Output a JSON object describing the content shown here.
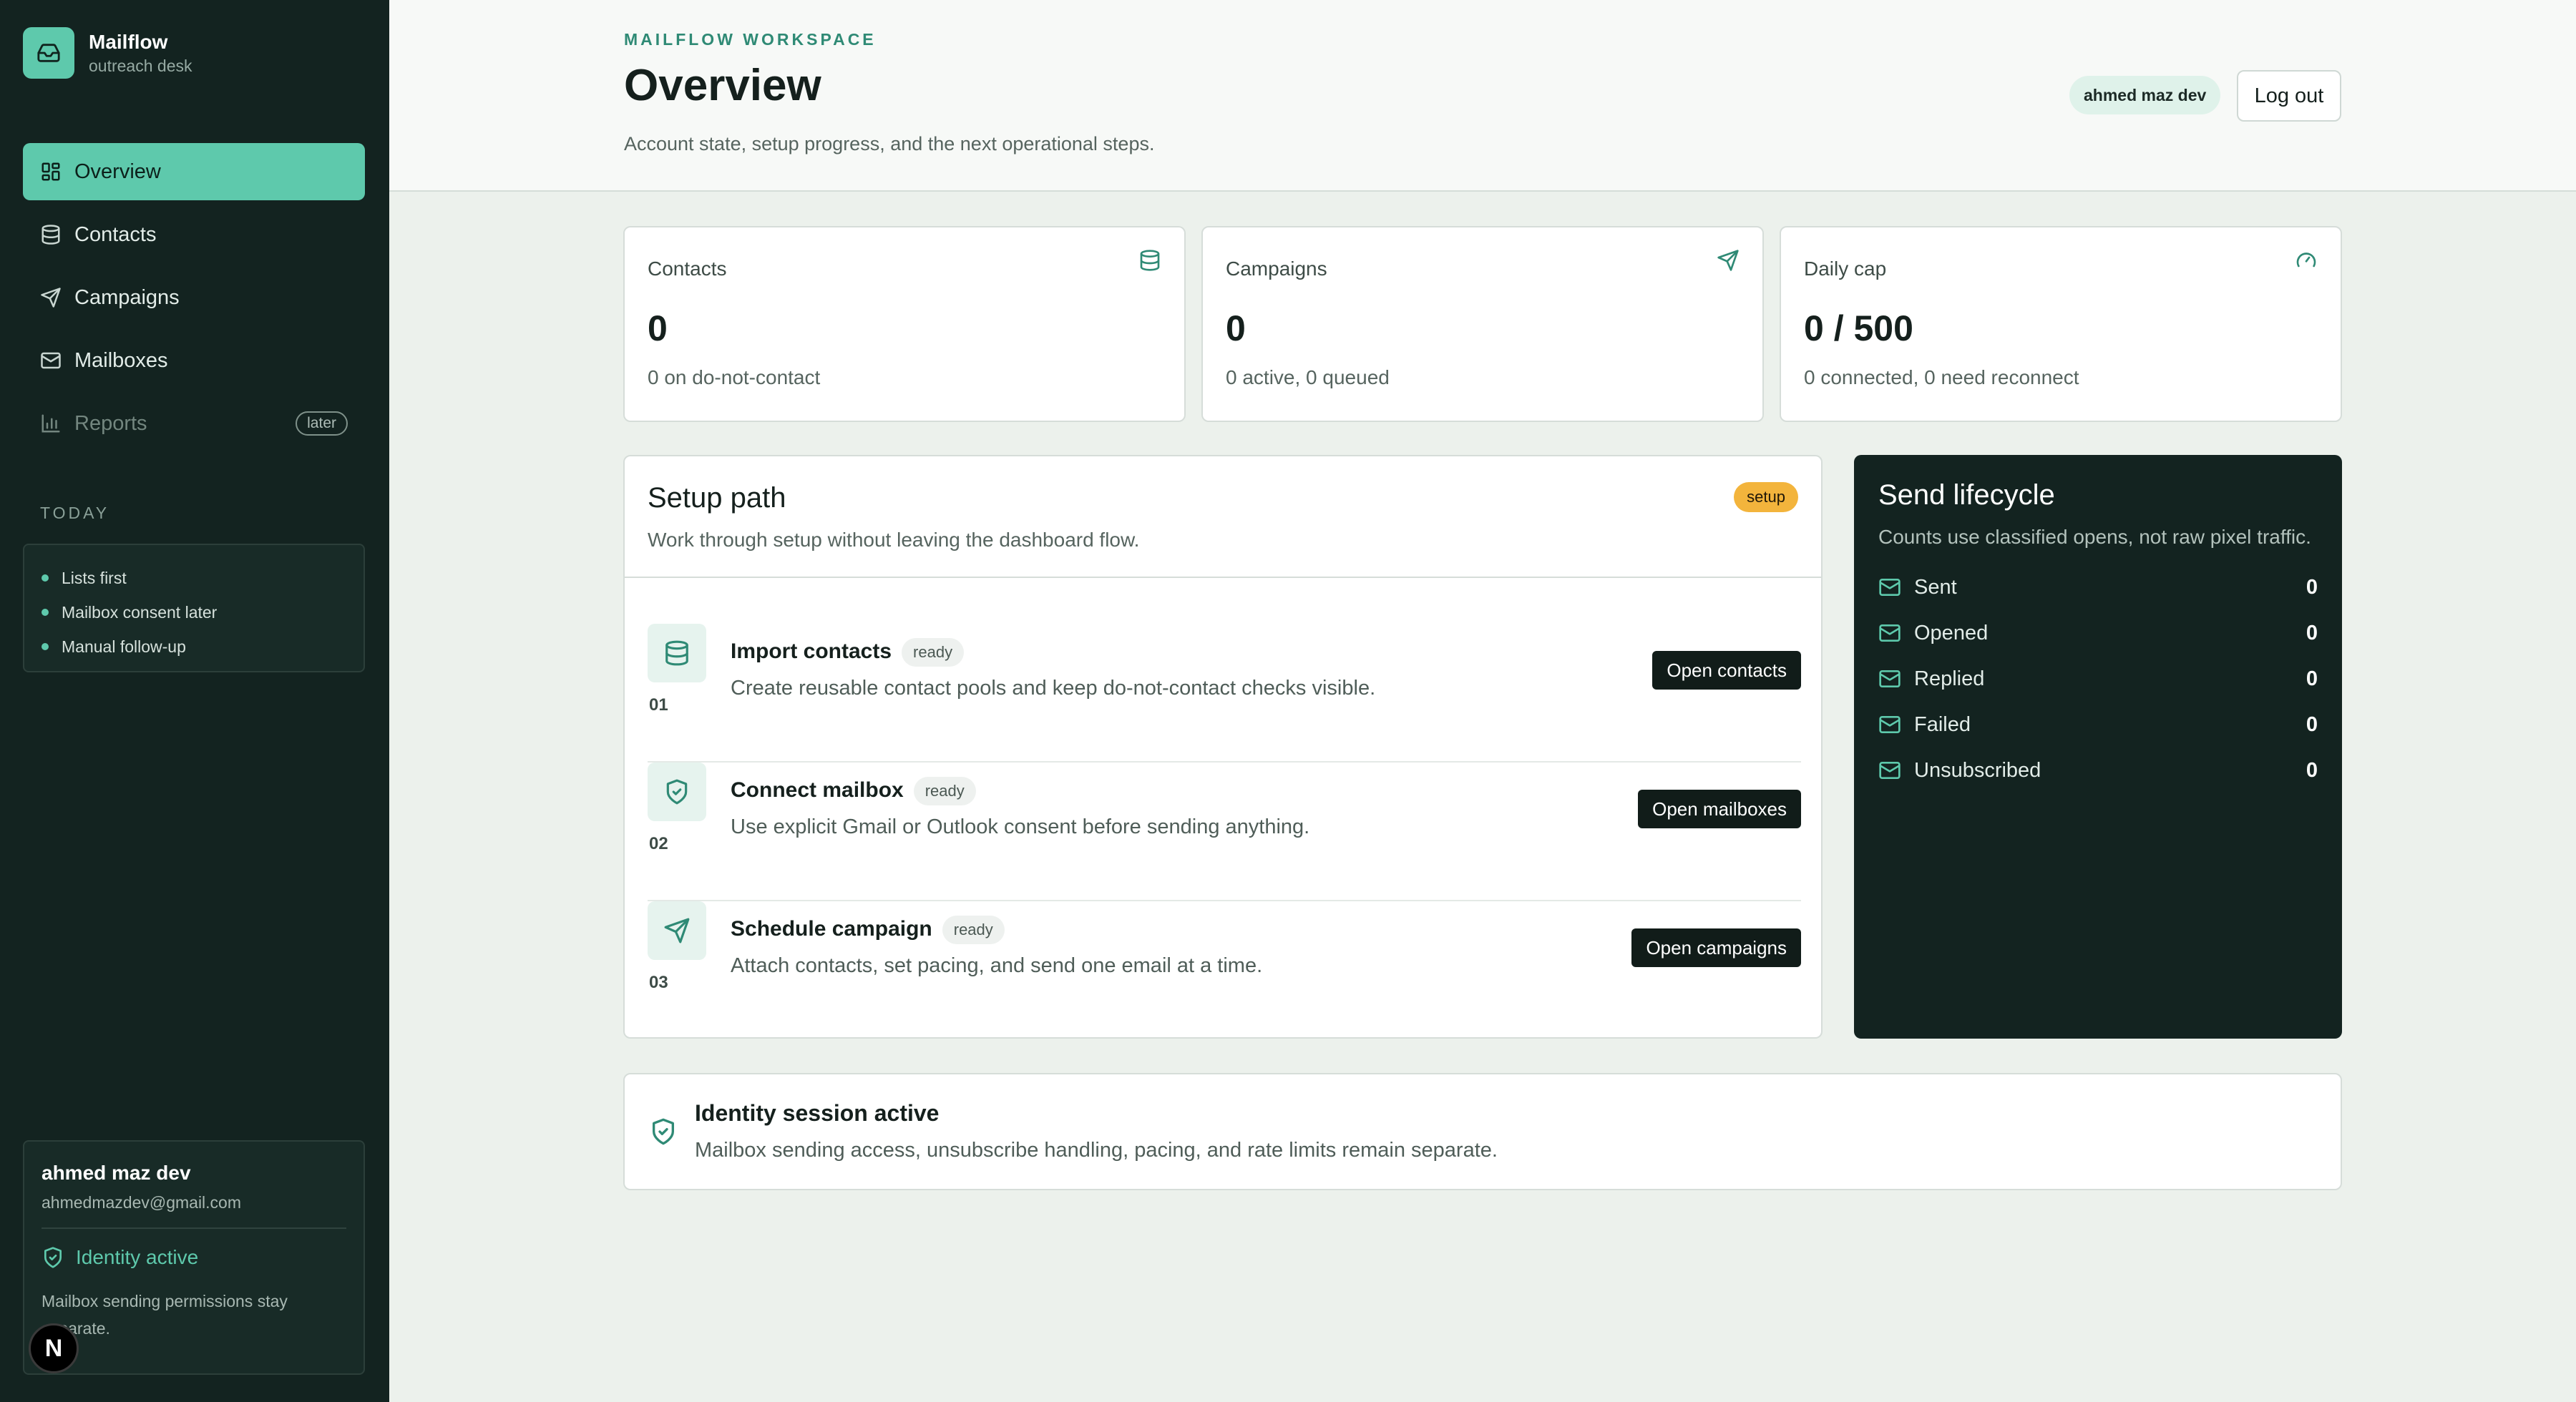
{
  "brand": {
    "name": "Mailflow",
    "subtitle": "outreach desk"
  },
  "nav": [
    {
      "label": "Overview",
      "icon": "layout-grid-icon",
      "active": true
    },
    {
      "label": "Contacts",
      "icon": "database-icon"
    },
    {
      "label": "Campaigns",
      "icon": "send-icon"
    },
    {
      "label": "Mailboxes",
      "icon": "mail-icon"
    },
    {
      "label": "Reports",
      "icon": "bar-chart-icon",
      "badge": "later",
      "disabled": true
    }
  ],
  "today": {
    "label": "TODAY",
    "items": [
      "Lists first",
      "Mailbox consent later",
      "Manual follow-up"
    ]
  },
  "user": {
    "name": "ahmed maz dev",
    "email": "ahmedmazdev@gmail.com",
    "identity_status": "Identity active",
    "note": "Mailbox sending permissions stay separate."
  },
  "floating_badge": "N",
  "header": {
    "eyebrow": "MAILFLOW WORKSPACE",
    "title": "Overview",
    "subtitle": "Account state, setup progress, and the next operational steps.",
    "user_pill": "ahmed maz dev",
    "logout": "Log out"
  },
  "stats": [
    {
      "label": "Contacts",
      "value": "0",
      "sub": "0 on do-not-contact",
      "icon": "database-icon"
    },
    {
      "label": "Campaigns",
      "value": "0",
      "sub": "0 active, 0 queued",
      "icon": "send-icon"
    },
    {
      "label": "Daily cap",
      "value": "0 / 500",
      "sub": "0 connected, 0 need reconnect",
      "icon": "gauge-icon"
    }
  ],
  "setup": {
    "title": "Setup path",
    "subtitle": "Work through setup without leaving the dashboard flow.",
    "badge": "setup",
    "steps": [
      {
        "num": "01",
        "title": "Import contacts",
        "status": "ready",
        "desc": "Create reusable contact pools and keep do-not-contact checks visible.",
        "button": "Open contacts",
        "icon": "database-icon"
      },
      {
        "num": "02",
        "title": "Connect mailbox",
        "status": "ready",
        "desc": "Use explicit Gmail or Outlook consent before sending anything.",
        "button": "Open mailboxes",
        "icon": "shield-check-icon"
      },
      {
        "num": "03",
        "title": "Schedule campaign",
        "status": "ready",
        "desc": "Attach contacts, set pacing, and send one email at a time.",
        "button": "Open campaigns",
        "icon": "send-icon"
      }
    ]
  },
  "lifecycle": {
    "title": "Send lifecycle",
    "subtitle": "Counts use classified opens, not raw pixel traffic.",
    "rows": [
      {
        "label": "Sent",
        "value": "0"
      },
      {
        "label": "Opened",
        "value": "0"
      },
      {
        "label": "Replied",
        "value": "0"
      },
      {
        "label": "Failed",
        "value": "0"
      },
      {
        "label": "Unsubscribed",
        "value": "0"
      }
    ]
  },
  "identity_card": {
    "title": "Identity session active",
    "subtitle": "Mailbox sending access, unsubscribe handling, pacing, and rate limits remain separate."
  },
  "colors": {
    "sidebar_bg": "#132320",
    "accent": "#5ec9ac",
    "setup_badge": "#f3b43c",
    "page_bg": "#ecf1ec"
  }
}
